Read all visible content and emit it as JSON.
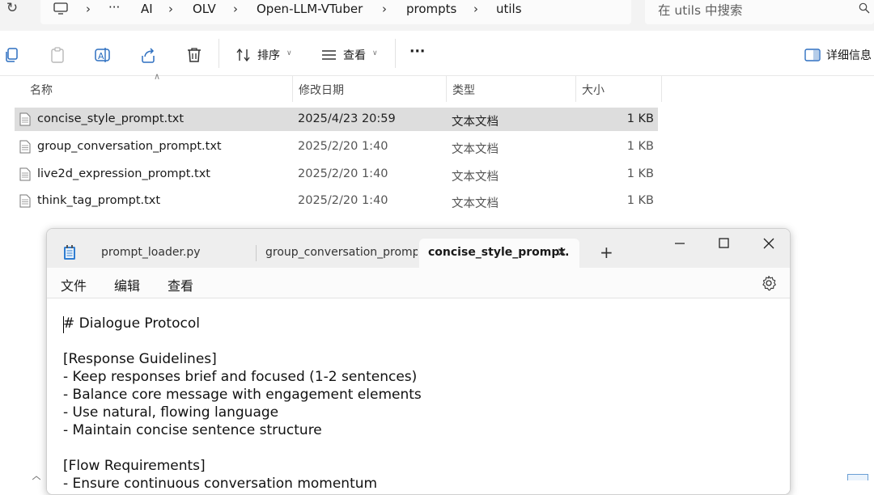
{
  "address_bar": {
    "crumbs": [
      "AI",
      "OLV",
      "Open-LLM-VTuber",
      "prompts",
      "utils"
    ],
    "ellipsis": "···",
    "separator": "›",
    "search_placeholder": "在 utils 中搜索"
  },
  "toolbar": {
    "sort_label": "排序",
    "view_label": "查看",
    "more_label": "···",
    "details_label": "详细信息"
  },
  "columns": {
    "name": "名称",
    "modified": "修改日期",
    "type": "类型",
    "size": "大小"
  },
  "files": [
    {
      "name": "concise_style_prompt.txt",
      "modified": "2025/4/23 20:59",
      "type": "文本文档",
      "size": "1 KB",
      "selected": true
    },
    {
      "name": "group_conversation_prompt.txt",
      "modified": "2025/2/20 1:40",
      "type": "文本文档",
      "size": "1 KB",
      "selected": false
    },
    {
      "name": "live2d_expression_prompt.txt",
      "modified": "2025/2/20 1:40",
      "type": "文本文档",
      "size": "1 KB",
      "selected": false
    },
    {
      "name": "think_tag_prompt.txt",
      "modified": "2025/2/20 1:40",
      "type": "文本文档",
      "size": "1 KB",
      "selected": false
    }
  ],
  "notepad": {
    "tabs": [
      "prompt_loader.py",
      "group_conversation_prompt.t",
      "concise_style_prompt."
    ],
    "tab_close": "✕",
    "new_tab": "+",
    "menu": [
      "文件",
      "编辑",
      "查看"
    ],
    "content_lines": [
      "# Dialogue Protocol",
      "",
      "[Response Guidelines]",
      "- Keep responses brief and focused (1-2 sentences)",
      "- Balance core message with engagement elements",
      "- Use natural, flowing language",
      "- Maintain concise sentence structure",
      "",
      "[Flow Requirements]",
      "- Ensure continuous conversation momentum"
    ]
  }
}
